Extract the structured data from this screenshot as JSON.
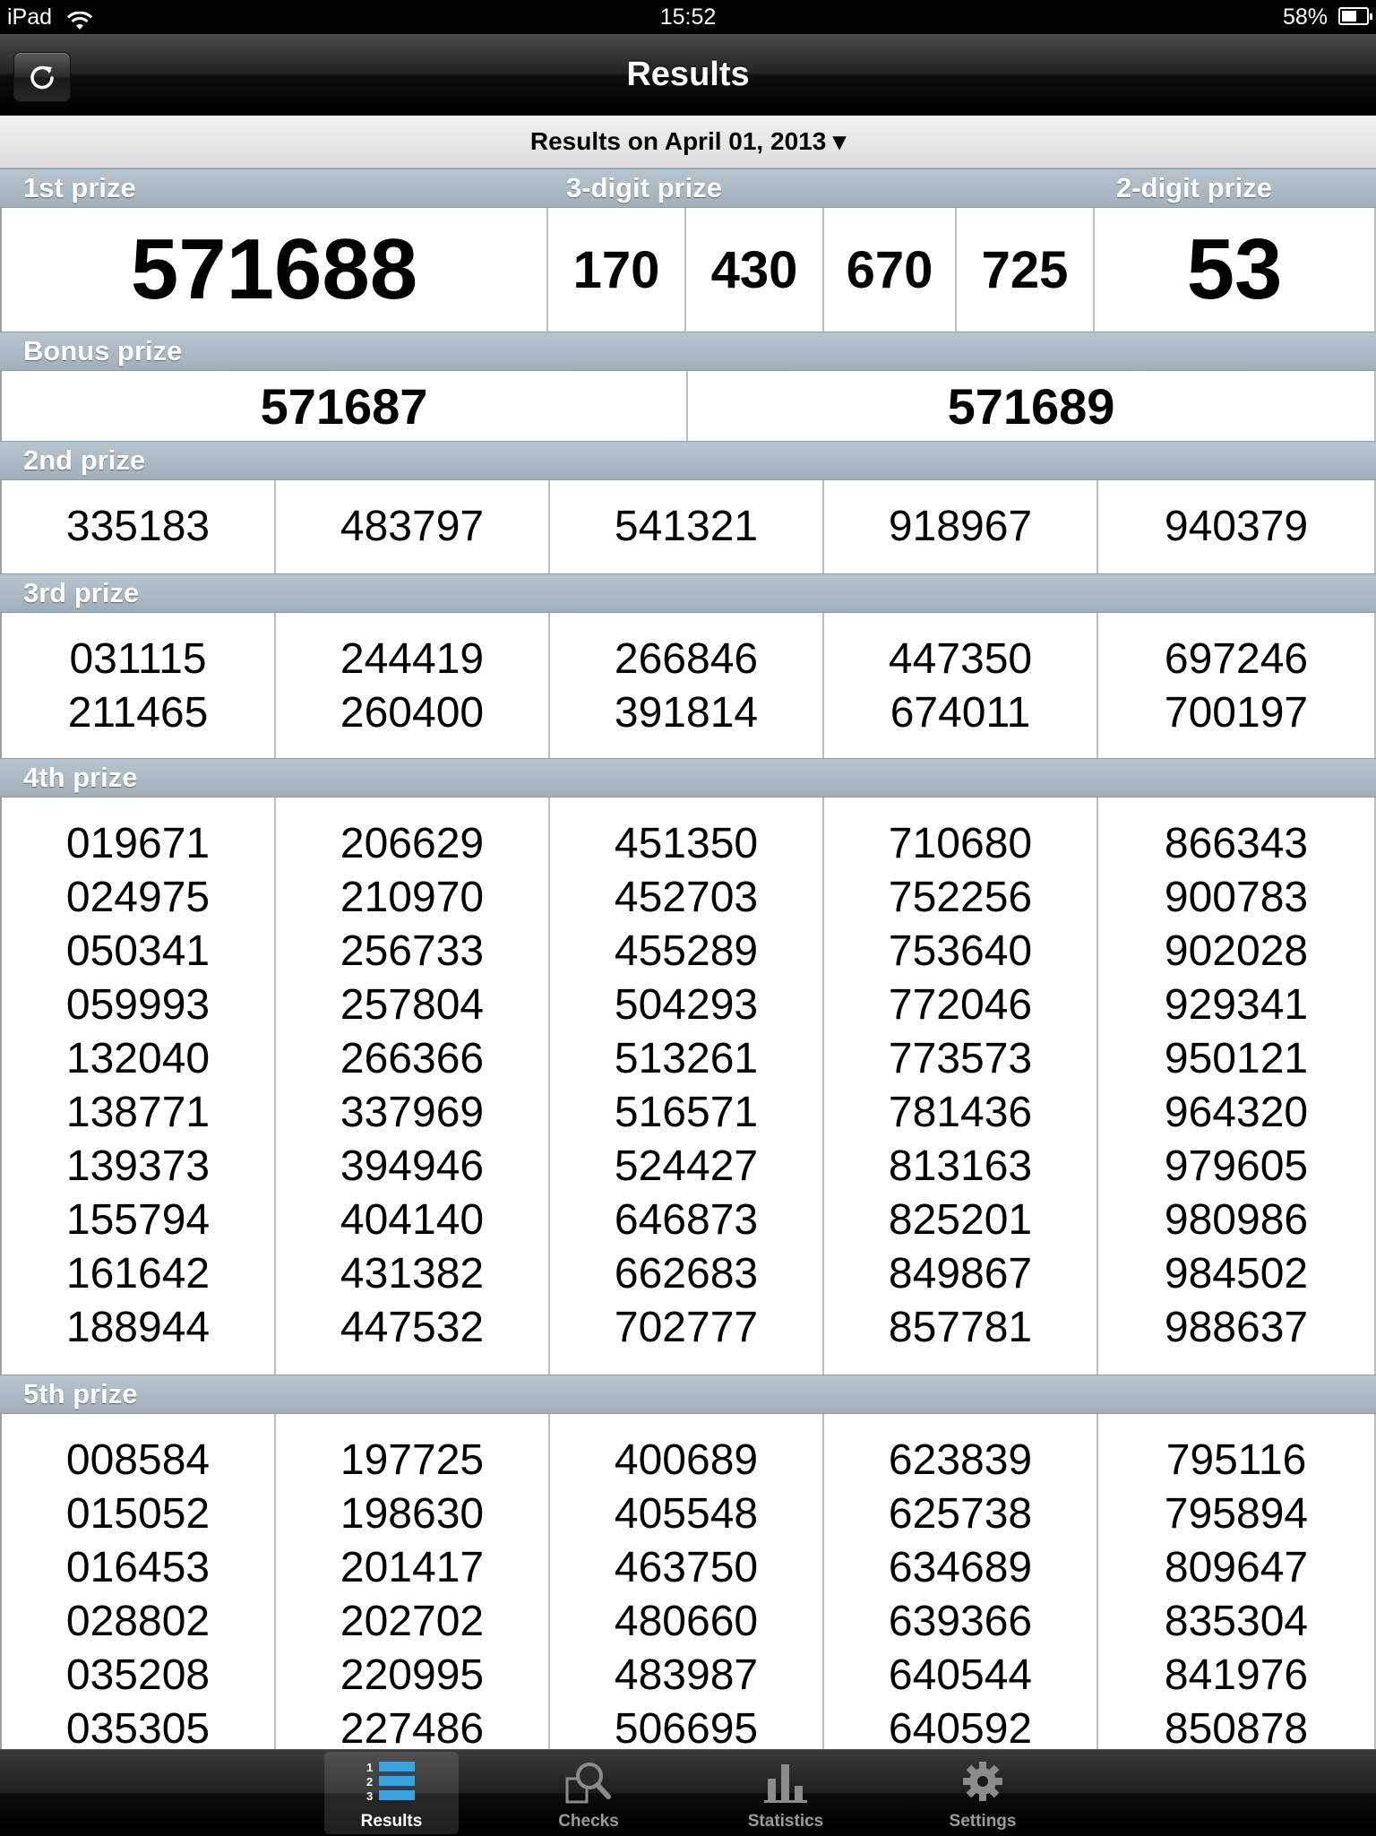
{
  "status_bar": {
    "carrier": "iPad",
    "time": "15:52",
    "battery": "58%"
  },
  "nav": {
    "title": "Results",
    "refresh_icon": "refresh-icon"
  },
  "date_bar": {
    "label": "Results on April 01, 2013 ▾"
  },
  "first_prize": {
    "label": "1st prize",
    "three_label": "3-digit prize",
    "two_label": "2-digit prize",
    "number": "571688",
    "three_digit": [
      "170",
      "430",
      "670",
      "725"
    ],
    "two_digit": "53"
  },
  "bonus": {
    "label": "Bonus prize",
    "numbers": [
      "571687",
      "571689"
    ]
  },
  "second": {
    "label": "2nd prize",
    "columns": [
      [
        "335183"
      ],
      [
        "483797"
      ],
      [
        "541321"
      ],
      [
        "918967"
      ],
      [
        "940379"
      ]
    ]
  },
  "third": {
    "label": "3rd prize",
    "columns": [
      [
        "031115",
        "211465"
      ],
      [
        "244419",
        "260400"
      ],
      [
        "266846",
        "391814"
      ],
      [
        "447350",
        "674011"
      ],
      [
        "697246",
        "700197"
      ]
    ]
  },
  "fourth": {
    "label": "4th prize",
    "columns": [
      [
        "019671",
        "024975",
        "050341",
        "059993",
        "132040",
        "138771",
        "139373",
        "155794",
        "161642",
        "188944"
      ],
      [
        "206629",
        "210970",
        "256733",
        "257804",
        "266366",
        "337969",
        "394946",
        "404140",
        "431382",
        "447532"
      ],
      [
        "451350",
        "452703",
        "455289",
        "504293",
        "513261",
        "516571",
        "524427",
        "646873",
        "662683",
        "702777"
      ],
      [
        "710680",
        "752256",
        "753640",
        "772046",
        "773573",
        "781436",
        "813163",
        "825201",
        "849867",
        "857781"
      ],
      [
        "866343",
        "900783",
        "902028",
        "929341",
        "950121",
        "964320",
        "979605",
        "980986",
        "984502",
        "988637"
      ]
    ]
  },
  "fifth": {
    "label": "5th prize",
    "columns": [
      [
        "008584",
        "015052",
        "016453",
        "028802",
        "035208",
        "035305"
      ],
      [
        "197725",
        "198630",
        "201417",
        "202702",
        "220995",
        "227486"
      ],
      [
        "400689",
        "405548",
        "463750",
        "480660",
        "483987",
        "506695"
      ],
      [
        "623839",
        "625738",
        "634689",
        "639366",
        "640544",
        "640592"
      ],
      [
        "795116",
        "795894",
        "809647",
        "835304",
        "841976",
        "850878"
      ]
    ]
  },
  "tabs": [
    {
      "label": "Results",
      "icon": "results-list-icon",
      "active": true
    },
    {
      "label": "Checks",
      "icon": "magnifier-icon",
      "active": false
    },
    {
      "label": "Statistics",
      "icon": "bar-chart-icon",
      "active": false
    },
    {
      "label": "Settings",
      "icon": "gear-icon",
      "active": false
    }
  ]
}
